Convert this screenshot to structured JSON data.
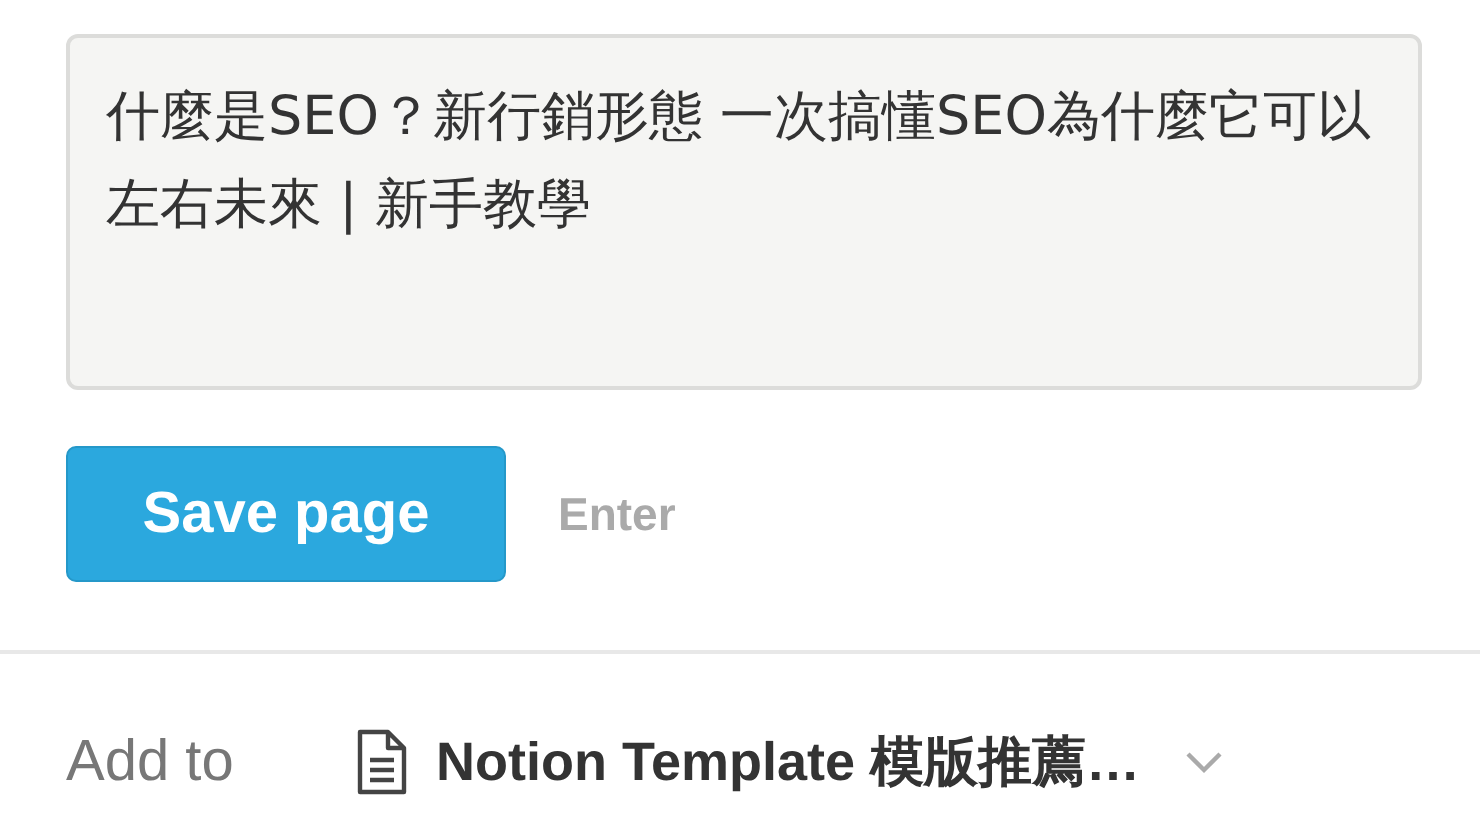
{
  "title_field": {
    "value": "什麼是SEO？新行銷形態 一次搞懂SEO為什麼它可以左右未來 | 新手教學"
  },
  "save_button": {
    "label": "Save page"
  },
  "shortcut_hint": "Enter",
  "add_to": {
    "label": "Add to",
    "page": "Notion Template 模版推薦…"
  }
}
